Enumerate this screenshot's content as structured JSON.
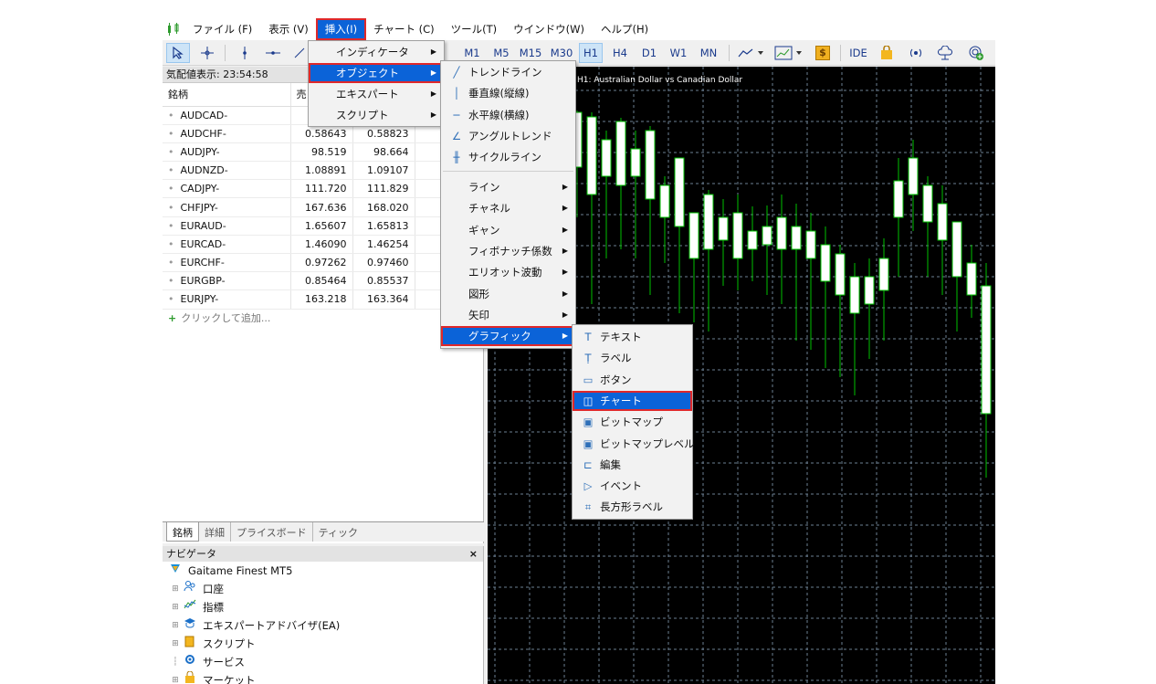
{
  "menubar": {
    "items": [
      {
        "label": "ファイル (F)"
      },
      {
        "label": "表示 (V)"
      },
      {
        "label": "挿入(I)"
      },
      {
        "label": "チャート (C)"
      },
      {
        "label": "ツール(T)"
      },
      {
        "label": "ウインドウ(W)"
      },
      {
        "label": "ヘルプ(H)"
      }
    ]
  },
  "toolbar": {
    "timeframes": [
      "M1",
      "M5",
      "M15",
      "M30",
      "H1",
      "H4",
      "D1",
      "W1",
      "MN"
    ],
    "ide_label": "IDE"
  },
  "market_watch": {
    "title": "気配値表示: 23:54:58",
    "columns": [
      "銘柄",
      "売"
    ],
    "rows": [
      {
        "symbol": "AUDCAD-",
        "bid": "",
        "ask": ""
      },
      {
        "symbol": "AUDCHF-",
        "bid": "0.58643",
        "ask": "0.58823"
      },
      {
        "symbol": "AUDJPY-",
        "bid": "98.519",
        "ask": "98.664"
      },
      {
        "symbol": "AUDNZD-",
        "bid": "1.08891",
        "ask": "1.09107"
      },
      {
        "symbol": "CADJPY-",
        "bid": "111.720",
        "ask": "111.829"
      },
      {
        "symbol": "CHFJPY-",
        "bid": "167.636",
        "ask": "168.020"
      },
      {
        "symbol": "EURAUD-",
        "bid": "1.65607",
        "ask": "1.65813"
      },
      {
        "symbol": "EURCAD-",
        "bid": "1.46090",
        "ask": "1.46254"
      },
      {
        "symbol": "EURCHF-",
        "bid": "0.97262",
        "ask": "0.97460"
      },
      {
        "symbol": "EURGBP-",
        "bid": "0.85464",
        "ask": "0.85537"
      },
      {
        "symbol": "EURJPY-",
        "bid": "163.218",
        "ask": "163.364"
      }
    ],
    "add_label": "クリックして追加...",
    "tabs": [
      "銘柄",
      "詳細",
      "プライスボード",
      "ティック"
    ]
  },
  "navigator": {
    "title": "ナビゲータ",
    "close": "×",
    "root": "Gaitame Finest MT5",
    "items": [
      {
        "label": "口座",
        "icon": "accounts-icon"
      },
      {
        "label": "指標",
        "icon": "indicators-icon"
      },
      {
        "label": "エキスパートアドバイザ(EA)",
        "icon": "expert-icon"
      },
      {
        "label": "スクリプト",
        "icon": "script-icon"
      },
      {
        "label": "サービス",
        "icon": "service-icon"
      },
      {
        "label": "マーケット",
        "icon": "market-icon"
      }
    ]
  },
  "chart": {
    "title": "H1:  Australian Dollar vs Canadian Dollar"
  },
  "insert_menu": {
    "items": [
      {
        "label": "インディケータ",
        "submenu": true
      },
      {
        "label": "オブジェクト",
        "submenu": true
      },
      {
        "label": "エキスパート",
        "submenu": true
      },
      {
        "label": "スクリプト",
        "submenu": true
      }
    ]
  },
  "objects_menu": {
    "top_items": [
      {
        "label": "トレンドライン",
        "icon": "trendline-icon",
        "glyph": "╱"
      },
      {
        "label": "垂直線(縦線)",
        "icon": "vertical-line-icon",
        "glyph": "│"
      },
      {
        "label": "水平線(横線)",
        "icon": "horizontal-line-icon",
        "glyph": "─"
      },
      {
        "label": "アングルトレンド",
        "icon": "angle-trend-icon",
        "glyph": "∠"
      },
      {
        "label": "サイクルライン",
        "icon": "cycle-lines-icon",
        "glyph": "╫"
      }
    ],
    "sub_items": [
      {
        "label": "ライン"
      },
      {
        "label": "チャネル"
      },
      {
        "label": "ギャン"
      },
      {
        "label": "フィボナッチ係数"
      },
      {
        "label": "エリオット波動"
      },
      {
        "label": "図形"
      },
      {
        "label": "矢印"
      },
      {
        "label": "グラフィック"
      }
    ]
  },
  "graphics_menu": {
    "items": [
      {
        "label": "テキスト",
        "icon": "text-icon",
        "glyph": "T"
      },
      {
        "label": "ラベル",
        "icon": "label-icon",
        "glyph": "Ṭ"
      },
      {
        "label": "ボタン",
        "icon": "button-icon",
        "glyph": "▭"
      },
      {
        "label": "チャート",
        "icon": "chart-icon",
        "glyph": "◫"
      },
      {
        "label": "ビットマップ",
        "icon": "bitmap-icon",
        "glyph": "▣"
      },
      {
        "label": "ビットマップレベル",
        "icon": "bitmap-label-icon",
        "glyph": "▣"
      },
      {
        "label": "編集",
        "icon": "edit-icon",
        "glyph": "⊏"
      },
      {
        "label": "イベント",
        "icon": "event-icon",
        "glyph": "▷"
      },
      {
        "label": "長方形ラベル",
        "icon": "rectangle-label-icon",
        "glyph": "⌗"
      }
    ]
  },
  "colors": {
    "highlight": "#0b63d8",
    "outline": "#e0282a",
    "bull_candle": "#ffffff",
    "wick": "#00c000",
    "grid": "#6b7f92",
    "chart_bg": "#000000"
  }
}
